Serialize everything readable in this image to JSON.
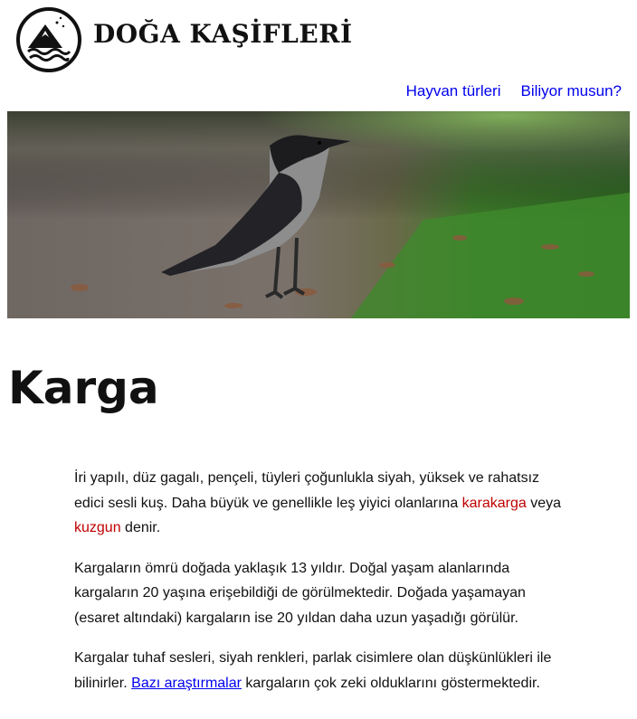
{
  "header": {
    "brand": "DOĞA KAŞİFLERİ",
    "logo_icon": "mountain-waves-logo-icon"
  },
  "nav": {
    "items": [
      {
        "label": "Hayvan türleri"
      },
      {
        "label": "Biliyor musun?"
      }
    ]
  },
  "hero": {
    "image": "hooded-crow-photo"
  },
  "page": {
    "title": "Karga"
  },
  "paragraphs": {
    "p1": {
      "t1": "İri yapılı, düz gagalı, pençeli, tüyleri çoğunlukla siyah, yüksek ve rahatsız edici sesli kuş. Daha büyük ve genellikle leş yiyici olanlarına ",
      "link1": "karakarga",
      "t2": " veya ",
      "link2": "kuzgun",
      "t3": " denir."
    },
    "p2": {
      "text": "Kargaların ömrü doğada yaklaşık 13 yıldır. Doğal yaşam alanlarında kargaların 20 yaşına erişebildiği de görülmektedir. Doğada yaşamayan (esaret altındaki) kargaların ise 20 yıldan daha uzun yaşadığı görülür."
    },
    "p3": {
      "t1": "Kargalar tuhaf sesleri, siyah renkleri, parlak cisimlere olan düşkünlükleri ile bilinirler. ",
      "link": "Bazı araştırmalar",
      "t2": " kargaların çok zeki olduklarını göstermektedir."
    }
  },
  "colors": {
    "nav_link": "#0000ee",
    "red_link": "#c00000",
    "text": "#111111"
  }
}
